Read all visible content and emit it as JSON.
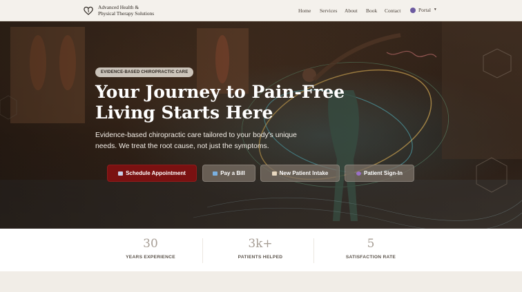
{
  "brand": {
    "line1": "Advanced Health &",
    "line2": "Physical Therapy Solutions"
  },
  "nav": {
    "home": "Home",
    "services": "Services",
    "about": "About",
    "book": "Book",
    "contact": "Contact",
    "portal": "Portal"
  },
  "hero": {
    "badge": "EVIDENCE-BASED CHIROPRACTIC CARE",
    "title_line1": "Your Journey to Pain-Free",
    "title_line2": "Living Starts Here",
    "subtitle": "Evidence-based chiropractic care tailored to your body's unique needs. We treat the root cause, not just the symptoms."
  },
  "buttons": {
    "schedule": "Schedule Appointment",
    "pay": "Pay a Bill",
    "intake": "New Patient Intake",
    "signin": "Patient Sign-In"
  },
  "stats": [
    {
      "value": "30",
      "label": "YEARS EXPERIENCE"
    },
    {
      "value": "3k+",
      "label": "PATIENTS HELPED"
    },
    {
      "value": "5",
      "label": "SATISFACTION RATE"
    }
  ],
  "colors": {
    "accent": "#7a1111",
    "header_bg": "#f4f1ec",
    "stat_number": "#a79e95"
  },
  "icons": {
    "logo": "heart-spine-logo",
    "portal": "user-icon",
    "schedule": "calendar-icon",
    "pay": "credit-card-icon",
    "intake": "clipboard-icon",
    "signin": "key-icon"
  }
}
